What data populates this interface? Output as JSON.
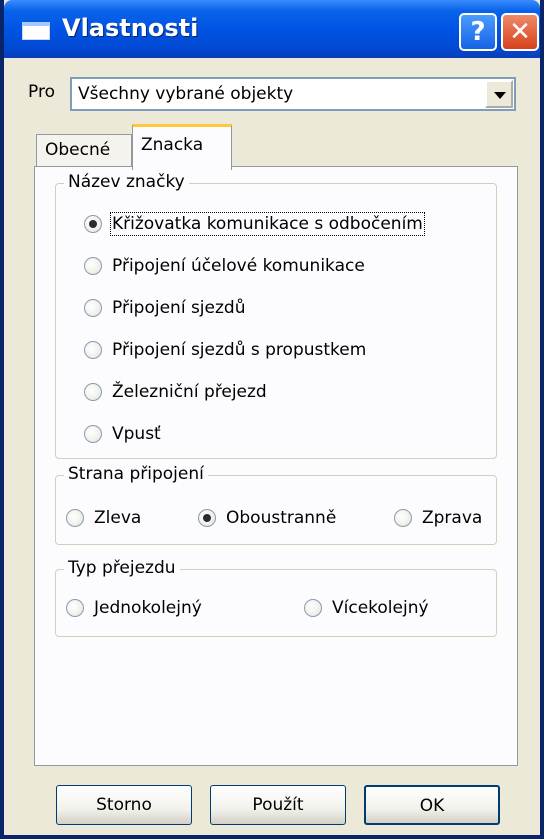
{
  "window": {
    "title": "Vlastnosti",
    "help_glyph": "?",
    "close_glyph": "✕"
  },
  "pro": {
    "label": "Pro",
    "selected": "Všechny vybrané objekty"
  },
  "tabs": [
    {
      "label": "Obecné",
      "active": false
    },
    {
      "label": "Znacka",
      "active": true
    }
  ],
  "nazev_znacky": {
    "legend": "Název značky",
    "options": [
      {
        "label": "Křižovatka komunikace s odbočením",
        "checked": true
      },
      {
        "label": "Připojení účelové komunikace",
        "checked": false
      },
      {
        "label": "Připojení sjezdů",
        "checked": false
      },
      {
        "label": "Připojení sjezdů s propustkem",
        "checked": false
      },
      {
        "label": "Železniční přejezd",
        "checked": false
      },
      {
        "label": "Vpusť",
        "checked": false
      }
    ]
  },
  "strana_pripojeni": {
    "legend": "Strana připojení",
    "options": [
      {
        "label": "Zleva",
        "checked": false
      },
      {
        "label": "Oboustranně",
        "checked": true
      },
      {
        "label": "Zprava",
        "checked": false
      }
    ]
  },
  "typ_prejezdu": {
    "legend": "Typ přejezdu",
    "options": [
      {
        "label": "Jednokolejný",
        "checked": false
      },
      {
        "label": "Vícekolejný",
        "checked": false
      }
    ]
  },
  "buttons": {
    "storno": "Storno",
    "pouzit": "Použít",
    "ok": "OK"
  }
}
